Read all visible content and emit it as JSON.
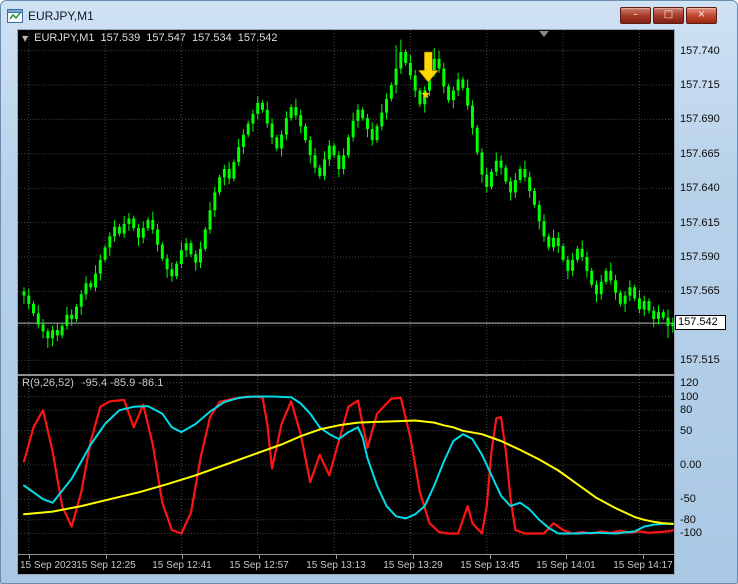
{
  "window": {
    "title": "EURJPY,M1",
    "controls": {
      "minimize": "–",
      "restore": "□",
      "close": "×"
    }
  },
  "colors": {
    "background": "#000000",
    "grid": "#474747",
    "bid_line": "#bdbdbd",
    "frame": "#b9d2ea"
  },
  "chart": {
    "info": {
      "marker": "▼",
      "symbol": "EURJPY,M1",
      "open": "157.539",
      "high": "157.547",
      "low": "157.534",
      "close": "157.542"
    },
    "bid_label": "157.542",
    "price_ticks": [
      {
        "v": 157.74,
        "label": "157.740"
      },
      {
        "v": 157.715,
        "label": "157.715"
      },
      {
        "v": 157.69,
        "label": "157.690"
      },
      {
        "v": 157.665,
        "label": "157.665"
      },
      {
        "v": 157.64,
        "label": "157.640"
      },
      {
        "v": 157.615,
        "label": "157.615"
      },
      {
        "v": 157.59,
        "label": "157.590"
      },
      {
        "v": 157.565,
        "label": "157.565"
      },
      {
        "v": 157.515,
        "label": "157.515"
      }
    ],
    "time_ticks": [
      {
        "label": "15 Sep 2023",
        "candle_index": 1,
        "align": "left"
      },
      {
        "label": "15 Sep 12:25",
        "candle_index": 17
      },
      {
        "label": "15 Sep 12:41",
        "candle_index": 33
      },
      {
        "label": "15 Sep 12:57",
        "candle_index": 49
      },
      {
        "label": "15 Sep 13:13",
        "candle_index": 65
      },
      {
        "label": "15 Sep 13:29",
        "candle_index": 81
      },
      {
        "label": "15 Sep 13:45",
        "candle_index": 97
      },
      {
        "label": "15 Sep 14:01",
        "candle_index": 113
      },
      {
        "label": "15 Sep 14:17",
        "candle_index": 129
      }
    ],
    "shift_marker": {
      "candle_index": 109
    }
  },
  "signal": {
    "type": "sell-arrow",
    "candle_index": 86,
    "color": "#ffd700",
    "star": "★",
    "arrow_top": 157.739,
    "arrow_tip": 157.717,
    "star_price": 157.709
  },
  "indicator": {
    "name": "R(9,26,52)",
    "values": "-95.4 -85.9 -86.1",
    "ticks": [
      {
        "v": 120,
        "label": "120"
      },
      {
        "v": 100,
        "label": "100"
      },
      {
        "v": 80,
        "label": "80"
      },
      {
        "v": 50,
        "label": "50"
      },
      {
        "v": 0,
        "label": "0.00"
      },
      {
        "v": -50,
        "label": "-50"
      },
      {
        "v": -80,
        "label": "-80"
      },
      {
        "v": -100,
        "label": "-100"
      }
    ]
  },
  "chart_data": [
    {
      "type": "candlestick",
      "symbol": "EURJPY",
      "timeframe": "M1",
      "date": "15 Sep 2023",
      "time_start": "12:08",
      "step_minutes": 1,
      "ylim": [
        157.505,
        157.755
      ],
      "color": "#00ff00",
      "bid": 157.542,
      "first_open": 157.565,
      "wick_pattern": [
        0.003,
        0.005,
        0.002,
        0.006,
        0.004,
        0.002
      ],
      "extreme_overrides": {
        "high": {
          "78": 157.744,
          "79": 157.748,
          "86": 157.742
        },
        "low": {
          "5": 157.524,
          "135": 157.531
        }
      },
      "grid_extra": [
        157.54
      ],
      "closes": [
        157.562,
        157.556,
        157.549,
        157.541,
        157.536,
        157.531,
        157.537,
        157.533,
        157.54,
        157.548,
        157.545,
        157.554,
        157.563,
        157.571,
        157.568,
        157.578,
        157.588,
        157.597,
        157.605,
        157.612,
        157.607,
        157.614,
        157.618,
        157.611,
        157.604,
        157.611,
        157.617,
        157.61,
        157.599,
        157.589,
        157.581,
        157.576,
        157.585,
        157.595,
        157.6,
        157.592,
        157.586,
        157.596,
        157.61,
        157.624,
        157.637,
        157.648,
        157.654,
        157.647,
        157.659,
        157.67,
        157.679,
        157.687,
        157.694,
        157.702,
        157.697,
        157.687,
        157.677,
        157.669,
        157.679,
        157.691,
        157.699,
        157.693,
        157.685,
        157.675,
        157.664,
        157.655,
        157.649,
        157.661,
        157.671,
        157.664,
        157.654,
        157.664,
        157.677,
        157.689,
        157.697,
        157.691,
        157.683,
        157.675,
        157.685,
        157.695,
        157.705,
        157.715,
        157.727,
        157.739,
        157.731,
        157.722,
        157.711,
        157.701,
        157.711,
        157.723,
        157.734,
        157.727,
        157.714,
        157.704,
        157.711,
        157.719,
        157.713,
        157.7,
        157.684,
        157.666,
        157.65,
        157.641,
        157.652,
        157.66,
        157.655,
        157.645,
        157.637,
        157.646,
        157.654,
        157.648,
        157.638,
        157.628,
        157.616,
        157.605,
        157.597,
        157.604,
        157.598,
        157.588,
        157.58,
        157.588,
        157.596,
        157.59,
        157.58,
        157.57,
        157.563,
        157.572,
        157.58,
        157.573,
        157.564,
        157.556,
        157.562,
        157.568,
        157.56,
        157.552,
        157.558,
        157.551,
        157.545,
        157.55,
        157.546,
        157.54,
        157.542
      ]
    },
    {
      "type": "line",
      "title": "R(9,26,52)",
      "ylim": [
        -130,
        130
      ],
      "current_values": [
        -95.4,
        -85.9,
        -86.1
      ],
      "series": [
        {
          "name": "R9",
          "color": "#ff1414",
          "width": 2.2,
          "points": [
            [
              0,
              5
            ],
            [
              2,
              55
            ],
            [
              4,
              80
            ],
            [
              6,
              20
            ],
            [
              8,
              -60
            ],
            [
              10,
              -90
            ],
            [
              12,
              -40
            ],
            [
              14,
              35
            ],
            [
              16,
              85
            ],
            [
              18,
              93
            ],
            [
              21,
              95
            ],
            [
              23,
              55
            ],
            [
              25,
              88
            ],
            [
              27,
              30
            ],
            [
              29,
              -55
            ],
            [
              31,
              -95
            ],
            [
              33,
              -100
            ],
            [
              35,
              -70
            ],
            [
              37,
              10
            ],
            [
              39,
              70
            ],
            [
              41,
              92
            ],
            [
              44,
              97
            ],
            [
              47,
              100
            ],
            [
              50,
              99
            ],
            [
              51,
              60
            ],
            [
              52,
              -5
            ],
            [
              54,
              60
            ],
            [
              56,
              93
            ],
            [
              58,
              45
            ],
            [
              60,
              -25
            ],
            [
              62,
              15
            ],
            [
              64,
              -15
            ],
            [
              66,
              35
            ],
            [
              68,
              85
            ],
            [
              70,
              94
            ],
            [
              72,
              25
            ],
            [
              74,
              75
            ],
            [
              77,
              97
            ],
            [
              79,
              98
            ],
            [
              81,
              40
            ],
            [
              83,
              -40
            ],
            [
              85,
              -85
            ],
            [
              87,
              -98
            ],
            [
              89,
              -100
            ],
            [
              91,
              -100
            ],
            [
              93,
              -60
            ],
            [
              94,
              -85
            ],
            [
              96,
              -100
            ],
            [
              97,
              -60
            ],
            [
              98,
              20
            ],
            [
              99,
              68
            ],
            [
              100,
              70
            ],
            [
              101,
              20
            ],
            [
              102,
              -50
            ],
            [
              103,
              -95
            ],
            [
              105,
              -100
            ],
            [
              107,
              -100
            ],
            [
              109,
              -100
            ],
            [
              111,
              -85
            ],
            [
              113,
              -95
            ],
            [
              115,
              -100
            ],
            [
              117,
              -98
            ],
            [
              119,
              -100
            ],
            [
              121,
              -97
            ],
            [
              123,
              -99
            ],
            [
              125,
              -96
            ],
            [
              127,
              -99
            ],
            [
              129,
              -97
            ],
            [
              131,
              -99
            ],
            [
              133,
              -98
            ],
            [
              135,
              -97
            ],
            [
              136,
              -95.4
            ]
          ]
        },
        {
          "name": "R26",
          "color": "#00dce8",
          "width": 2,
          "points": [
            [
              0,
              -30
            ],
            [
              4,
              -50
            ],
            [
              6,
              -55
            ],
            [
              10,
              -20
            ],
            [
              14,
              30
            ],
            [
              17,
              60
            ],
            [
              20,
              80
            ],
            [
              23,
              85
            ],
            [
              26,
              86
            ],
            [
              29,
              75
            ],
            [
              31,
              55
            ],
            [
              33,
              48
            ],
            [
              36,
              60
            ],
            [
              39,
              78
            ],
            [
              42,
              92
            ],
            [
              45,
              98
            ],
            [
              48,
              100
            ],
            [
              52,
              100
            ],
            [
              56,
              99
            ],
            [
              58,
              90
            ],
            [
              60,
              75
            ],
            [
              62,
              55
            ],
            [
              64,
              45
            ],
            [
              66,
              38
            ],
            [
              68,
              48
            ],
            [
              70,
              55
            ],
            [
              71,
              40
            ],
            [
              72,
              10
            ],
            [
              74,
              -30
            ],
            [
              76,
              -60
            ],
            [
              78,
              -75
            ],
            [
              80,
              -78
            ],
            [
              82,
              -72
            ],
            [
              84,
              -60
            ],
            [
              86,
              -30
            ],
            [
              88,
              5
            ],
            [
              90,
              35
            ],
            [
              92,
              45
            ],
            [
              94,
              38
            ],
            [
              96,
              15
            ],
            [
              98,
              -15
            ],
            [
              100,
              -45
            ],
            [
              102,
              -60
            ],
            [
              104,
              -55
            ],
            [
              106,
              -65
            ],
            [
              108,
              -80
            ],
            [
              110,
              -92
            ],
            [
              112,
              -100
            ],
            [
              116,
              -100
            ],
            [
              120,
              -99
            ],
            [
              124,
              -100
            ],
            [
              128,
              -97
            ],
            [
              130,
              -90
            ],
            [
              132,
              -87
            ],
            [
              134,
              -86
            ],
            [
              136,
              -85.9
            ]
          ]
        },
        {
          "name": "R52",
          "color": "#ffff00",
          "width": 2,
          "points": [
            [
              0,
              -72
            ],
            [
              6,
              -68
            ],
            [
              12,
              -60
            ],
            [
              18,
              -50
            ],
            [
              24,
              -40
            ],
            [
              30,
              -28
            ],
            [
              36,
              -15
            ],
            [
              42,
              0
            ],
            [
              48,
              15
            ],
            [
              54,
              30
            ],
            [
              58,
              42
            ],
            [
              62,
              52
            ],
            [
              66,
              58
            ],
            [
              70,
              62
            ],
            [
              74,
              63
            ],
            [
              78,
              64
            ],
            [
              82,
              65
            ],
            [
              86,
              62
            ],
            [
              88,
              58
            ],
            [
              90,
              55
            ],
            [
              92,
              50
            ],
            [
              96,
              45
            ],
            [
              100,
              35
            ],
            [
              104,
              22
            ],
            [
              108,
              8
            ],
            [
              112,
              -8
            ],
            [
              116,
              -28
            ],
            [
              120,
              -48
            ],
            [
              124,
              -63
            ],
            [
              128,
              -76
            ],
            [
              130,
              -80
            ],
            [
              132,
              -83
            ],
            [
              134,
              -85
            ],
            [
              136,
              -86.1
            ]
          ]
        }
      ]
    }
  ]
}
